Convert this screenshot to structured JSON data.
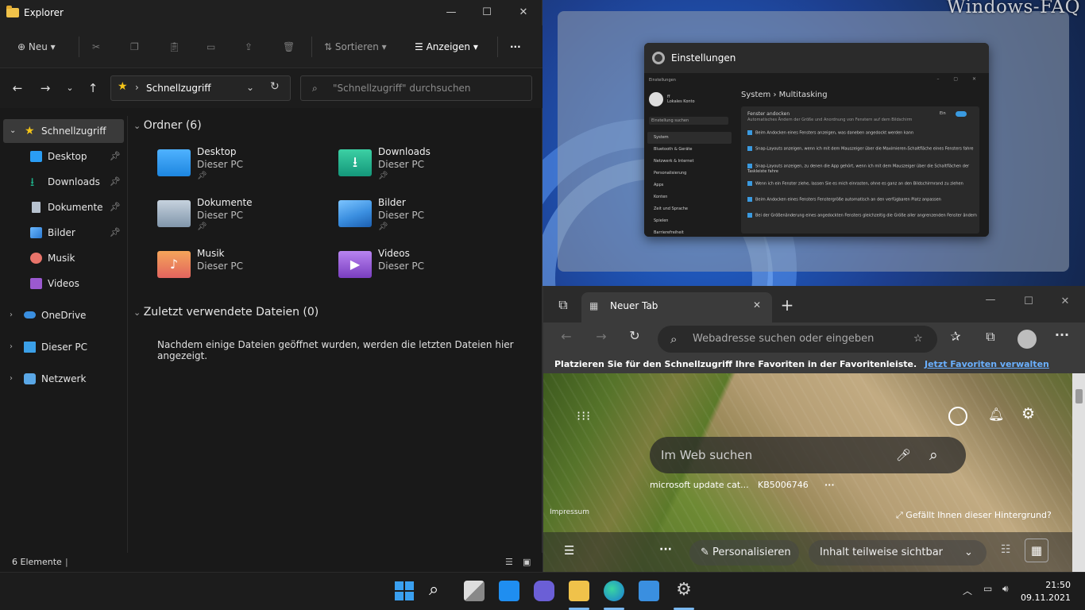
{
  "desktop": {
    "watermark": "Windows-FAQ"
  },
  "settings_window": {
    "title": "Einstellungen",
    "inner_top": "Einstellungen",
    "winbtns": "– ▢ ✕",
    "user_name": "ff",
    "user_sub": "Lokales Konto",
    "search": "Einstellung suchen",
    "nav": [
      "System",
      "Bluetooth & Geräte",
      "Netzwerk & Internet",
      "Personalisierung",
      "Apps",
      "Konten",
      "Zeit und Sprache",
      "Spielen",
      "Barrierefreiheit"
    ],
    "breadcrumb": "System  ›  Multitasking",
    "card_title": "Fenster andocken",
    "card_sub": "Automatisches Ändern der Größe und Anordnung von Fenstern auf dem Bildschirm",
    "toggle_label": "Ein",
    "options": [
      "Beim Andocken eines Fensters anzeigen, was daneben angedockt werden kann",
      "Snap-Layouts anzeigen, wenn ich mit dem Mauszeiger über die Maximieren-Schaltfläche eines Fensters fahre",
      "Snap-Layouts anzeigen, zu denen die App gehört, wenn ich mit dem Mauszeiger über die Schaltflächen der Taskleiste fahre",
      "Wenn ich ein Fenster ziehe, lassen Sie es mich einrasten, ohne es ganz an den Bildschirmrand zu ziehen",
      "Beim Andocken eines Fensters Fenstergröße automatisch an den verfügbaren Platz anpassen",
      "Bei der Größenänderung eines angedockten Fensters gleichzeitig die Größe aller angrenzenden Fenster ändern"
    ]
  },
  "explorer": {
    "title": "Explorer",
    "toolbar": {
      "new": "Neu",
      "sort": "Sortieren",
      "view": "Anzeigen",
      "more": "···"
    },
    "address": "Schnellzugriff",
    "search_placeholder": "\"Schnellzugriff\" durchsuchen",
    "sidebar": {
      "quick": "Schnellzugriff",
      "pinned": [
        "Desktop",
        "Downloads",
        "Dokumente",
        "Bilder"
      ],
      "music": "Musik",
      "videos": "Videos",
      "onedrive": "OneDrive",
      "thispc": "Dieser PC",
      "network": "Netzwerk"
    },
    "folders_header": "Ordner (6)",
    "folders": [
      {
        "name": "Desktop",
        "sub": "Dieser PC",
        "pinned": true,
        "color": "#2a9df4"
      },
      {
        "name": "Downloads",
        "sub": "Dieser PC",
        "pinned": true,
        "color": "#1fb089"
      },
      {
        "name": "Dokumente",
        "sub": "Dieser PC",
        "pinned": true,
        "color": "#8fa3b8"
      },
      {
        "name": "Bilder",
        "sub": "Dieser PC",
        "pinned": true,
        "color": "#3b8fe0"
      },
      {
        "name": "Musik",
        "sub": "Dieser PC",
        "pinned": false,
        "color": "#e8746a"
      },
      {
        "name": "Videos",
        "sub": "Dieser PC",
        "pinned": false,
        "color": "#9b59d0"
      }
    ],
    "recent_header": "Zuletzt verwendete Dateien (0)",
    "recent_empty": "Nachdem einige Dateien geöffnet wurden, werden die letzten Dateien hier angezeigt.",
    "status": "6 Elemente"
  },
  "edge": {
    "tab_title": "Neuer Tab",
    "omnibox_placeholder": "Webadresse suchen oder eingeben",
    "favbar_text": "Platzieren Sie für den Schnellzugriff Ihre Favoriten in der Favoritenleiste.",
    "favbar_link": "Jetzt Favoriten verwalten",
    "ntp": {
      "search_placeholder": "Im Web suchen",
      "quick_links": [
        "microsoft update cat...",
        "KB5006746"
      ],
      "imprint": "Impressum",
      "like_bg": "Gefällt Ihnen dieser Hintergrund?",
      "personalize": "Personalisieren",
      "content_select": "Inhalt teilweise sichtbar"
    }
  },
  "taskbar": {
    "time": "21:50",
    "date": "09.11.2021"
  }
}
